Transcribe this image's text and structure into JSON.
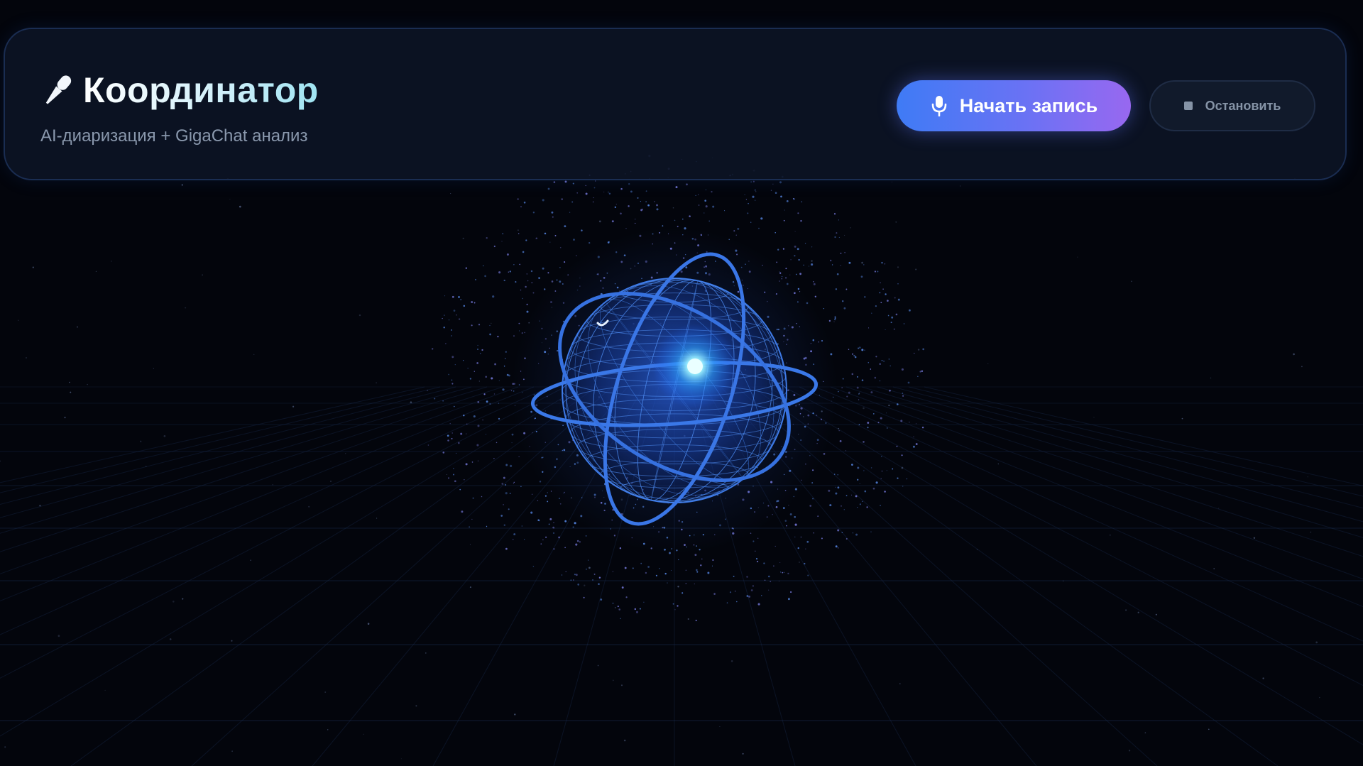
{
  "header": {
    "title": "Координатор",
    "subtitle": "AI-диаризация + GigaChat анализ",
    "title_icon": "microphone-icon"
  },
  "controls": {
    "start_label": "Начать запись",
    "start_icon": "microphone-icon",
    "stop_label": "Остановить",
    "stop_icon": "stop-square-icon"
  },
  "theme": {
    "background": "#03050c",
    "accent_start": "#3f7bf5",
    "accent_end": "#9868f0",
    "globe_color": "#2f6fe0",
    "glow_color": "#6fe6ff"
  }
}
